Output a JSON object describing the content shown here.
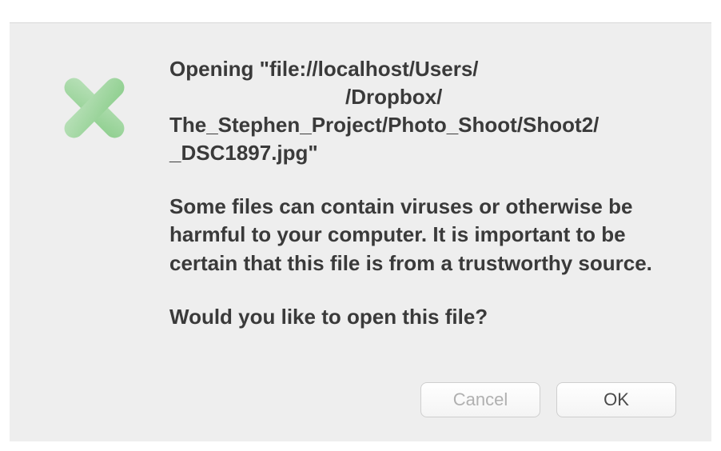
{
  "dialog": {
    "heading_line1": "Opening \"file://localhost/Users/",
    "heading_line2_prefix": "",
    "heading_line2_suffix": "/Dropbox/",
    "heading_line3": "The_Stephen_Project/Photo_Shoot/Shoot2/",
    "heading_line4": "_DSC1897.jpg\"",
    "body": "Some files can contain viruses or otherwise be harmful to your computer.  It is important to be certain that this file is from a trustworthy source.",
    "question": "Would you like to open this file?",
    "buttons": {
      "cancel": "Cancel",
      "ok": "OK"
    }
  }
}
